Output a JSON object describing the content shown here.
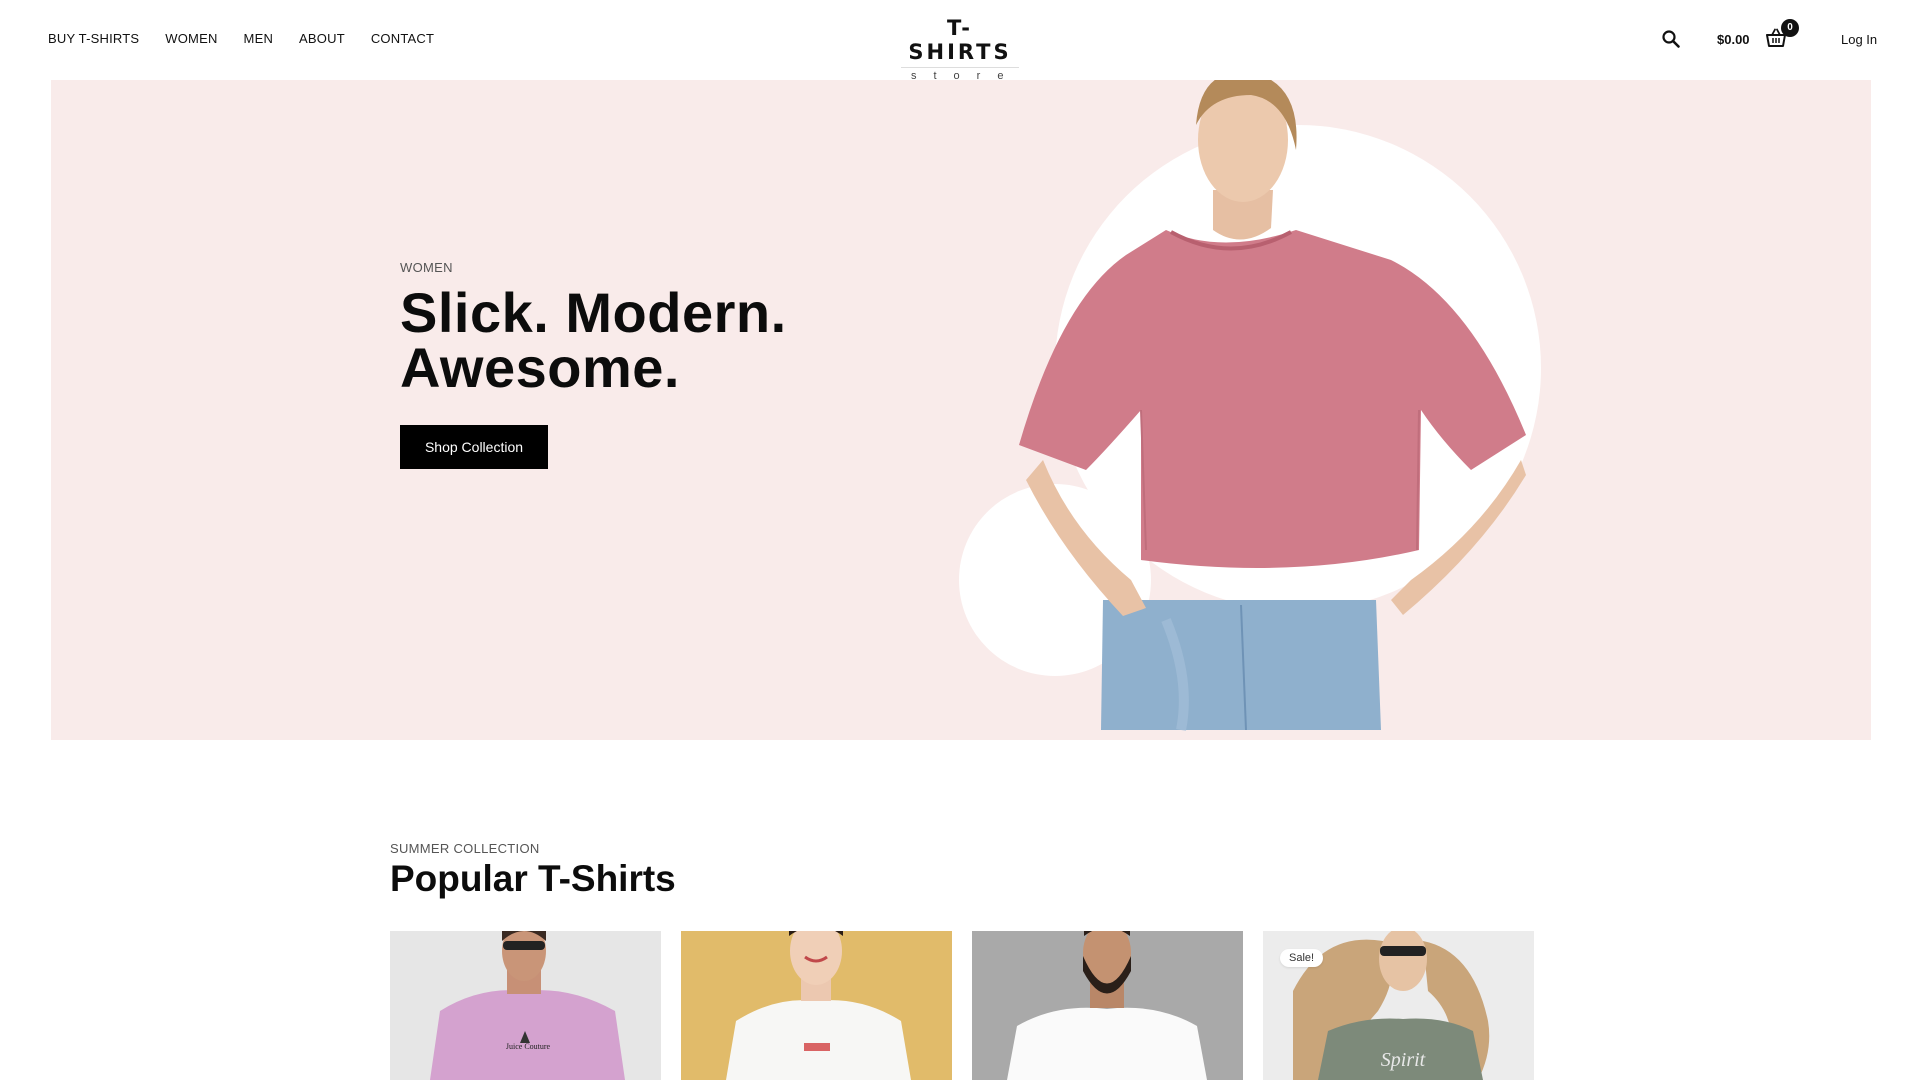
{
  "nav": {
    "items": [
      "BUY T-SHIRTS",
      "WOMEN",
      "MEN",
      "ABOUT",
      "CONTACT"
    ]
  },
  "logo": {
    "title": "T-SHIRTS",
    "subtitle": "store"
  },
  "header": {
    "cart_total": "$0.00",
    "cart_count": "0",
    "login_label": "Log In",
    "search_icon": "search-icon",
    "cart_icon": "basket-icon"
  },
  "hero": {
    "eyebrow": "WOMEN",
    "title_line1": "Slick. Modern.",
    "title_line2": "Awesome.",
    "cta_label": "Shop Collection",
    "background_color": "#f9ebea"
  },
  "collection": {
    "eyebrow": "SUMMER COLLECTION",
    "title": "Popular T-Shirts",
    "products": [
      {
        "badge": "",
        "image": "man in pink t-shirt"
      },
      {
        "badge": "",
        "image": "woman in white t-shirt"
      },
      {
        "badge": "",
        "image": "bearded man in white t-shirt"
      },
      {
        "badge": "Sale!",
        "image": "woman in grey t-shirt"
      }
    ]
  },
  "colors": {
    "accent": "#000000",
    "hero_bg": "#f9ebea",
    "shirt_pink": "#d07c8a"
  }
}
